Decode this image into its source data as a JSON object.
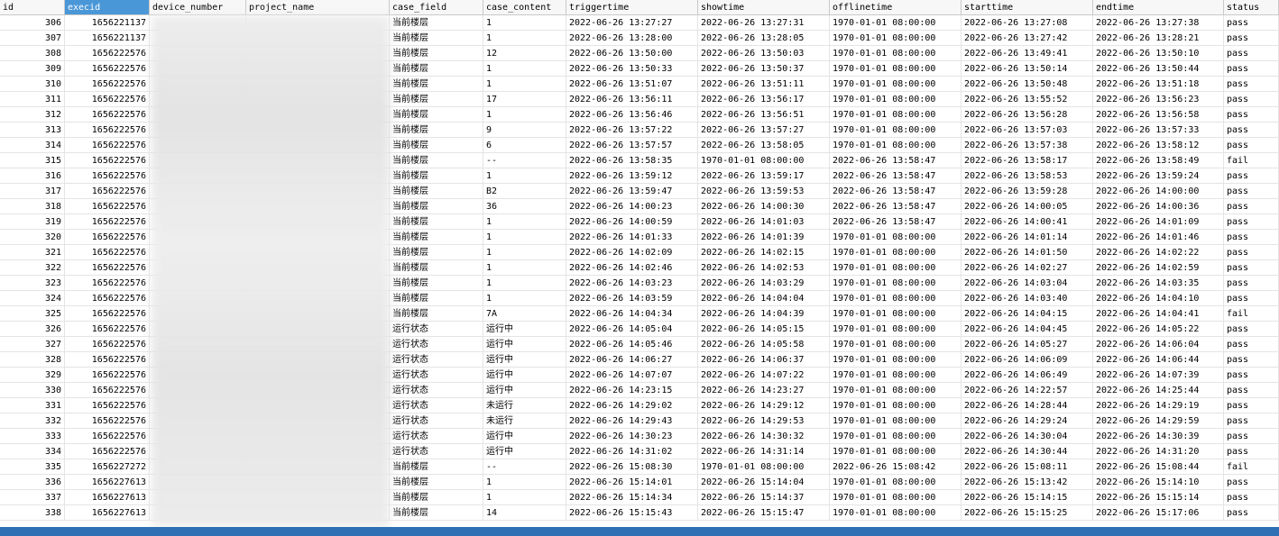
{
  "columns": [
    "id",
    "execid",
    "device_number",
    "project_name",
    "case_field",
    "case_content",
    "triggertime",
    "showtime",
    "offlinetime",
    "starttime",
    "endtime",
    "status"
  ],
  "selected_column": "execid",
  "rows": [
    [
      "306",
      "1656221137",
      "",
      "",
      "当前楼层",
      "1",
      "2022-06-26 13:27:27",
      "2022-06-26 13:27:31",
      "1970-01-01 08:00:00",
      "2022-06-26 13:27:08",
      "2022-06-26 13:27:38",
      "pass"
    ],
    [
      "307",
      "1656221137",
      "",
      "",
      "当前楼层",
      "1",
      "2022-06-26 13:28:00",
      "2022-06-26 13:28:05",
      "1970-01-01 08:00:00",
      "2022-06-26 13:27:42",
      "2022-06-26 13:28:21",
      "pass"
    ],
    [
      "308",
      "1656222576",
      "",
      "",
      "当前楼层",
      "12",
      "2022-06-26 13:50:00",
      "2022-06-26 13:50:03",
      "1970-01-01 08:00:00",
      "2022-06-26 13:49:41",
      "2022-06-26 13:50:10",
      "pass"
    ],
    [
      "309",
      "1656222576",
      "",
      "",
      "当前楼层",
      "1",
      "2022-06-26 13:50:33",
      "2022-06-26 13:50:37",
      "1970-01-01 08:00:00",
      "2022-06-26 13:50:14",
      "2022-06-26 13:50:44",
      "pass"
    ],
    [
      "310",
      "1656222576",
      "",
      "",
      "当前楼层",
      "1",
      "2022-06-26 13:51:07",
      "2022-06-26 13:51:11",
      "1970-01-01 08:00:00",
      "2022-06-26 13:50:48",
      "2022-06-26 13:51:18",
      "pass"
    ],
    [
      "311",
      "1656222576",
      "",
      "",
      "当前楼层",
      "17",
      "2022-06-26 13:56:11",
      "2022-06-26 13:56:17",
      "1970-01-01 08:00:00",
      "2022-06-26 13:55:52",
      "2022-06-26 13:56:23",
      "pass"
    ],
    [
      "312",
      "1656222576",
      "",
      "",
      "当前楼层",
      "1",
      "2022-06-26 13:56:46",
      "2022-06-26 13:56:51",
      "1970-01-01 08:00:00",
      "2022-06-26 13:56:28",
      "2022-06-26 13:56:58",
      "pass"
    ],
    [
      "313",
      "1656222576",
      "",
      "",
      "当前楼层",
      "9",
      "2022-06-26 13:57:22",
      "2022-06-26 13:57:27",
      "1970-01-01 08:00:00",
      "2022-06-26 13:57:03",
      "2022-06-26 13:57:33",
      "pass"
    ],
    [
      "314",
      "1656222576",
      "",
      "",
      "当前楼层",
      "6",
      "2022-06-26 13:57:57",
      "2022-06-26 13:58:05",
      "1970-01-01 08:00:00",
      "2022-06-26 13:57:38",
      "2022-06-26 13:58:12",
      "pass"
    ],
    [
      "315",
      "1656222576",
      "",
      "",
      "当前楼层",
      "--",
      "2022-06-26 13:58:35",
      "1970-01-01 08:00:00",
      "2022-06-26 13:58:47",
      "2022-06-26 13:58:17",
      "2022-06-26 13:58:49",
      "fail"
    ],
    [
      "316",
      "1656222576",
      "",
      "",
      "当前楼层",
      "1",
      "2022-06-26 13:59:12",
      "2022-06-26 13:59:17",
      "2022-06-26 13:58:47",
      "2022-06-26 13:58:53",
      "2022-06-26 13:59:24",
      "pass"
    ],
    [
      "317",
      "1656222576",
      "",
      "",
      "当前楼层",
      "B2",
      "2022-06-26 13:59:47",
      "2022-06-26 13:59:53",
      "2022-06-26 13:58:47",
      "2022-06-26 13:59:28",
      "2022-06-26 14:00:00",
      "pass"
    ],
    [
      "318",
      "1656222576",
      "",
      "",
      "当前楼层",
      "36",
      "2022-06-26 14:00:23",
      "2022-06-26 14:00:30",
      "2022-06-26 13:58:47",
      "2022-06-26 14:00:05",
      "2022-06-26 14:00:36",
      "pass"
    ],
    [
      "319",
      "1656222576",
      "",
      "",
      "当前楼层",
      "1",
      "2022-06-26 14:00:59",
      "2022-06-26 14:01:03",
      "2022-06-26 13:58:47",
      "2022-06-26 14:00:41",
      "2022-06-26 14:01:09",
      "pass"
    ],
    [
      "320",
      "1656222576",
      "",
      "",
      "当前楼层",
      "1",
      "2022-06-26 14:01:33",
      "2022-06-26 14:01:39",
      "1970-01-01 08:00:00",
      "2022-06-26 14:01:14",
      "2022-06-26 14:01:46",
      "pass"
    ],
    [
      "321",
      "1656222576",
      "",
      "",
      "当前楼层",
      "1",
      "2022-06-26 14:02:09",
      "2022-06-26 14:02:15",
      "1970-01-01 08:00:00",
      "2022-06-26 14:01:50",
      "2022-06-26 14:02:22",
      "pass"
    ],
    [
      "322",
      "1656222576",
      "",
      "",
      "当前楼层",
      "1",
      "2022-06-26 14:02:46",
      "2022-06-26 14:02:53",
      "1970-01-01 08:00:00",
      "2022-06-26 14:02:27",
      "2022-06-26 14:02:59",
      "pass"
    ],
    [
      "323",
      "1656222576",
      "",
      "",
      "当前楼层",
      "1",
      "2022-06-26 14:03:23",
      "2022-06-26 14:03:29",
      "1970-01-01 08:00:00",
      "2022-06-26 14:03:04",
      "2022-06-26 14:03:35",
      "pass"
    ],
    [
      "324",
      "1656222576",
      "",
      "",
      "当前楼层",
      "1",
      "2022-06-26 14:03:59",
      "2022-06-26 14:04:04",
      "1970-01-01 08:00:00",
      "2022-06-26 14:03:40",
      "2022-06-26 14:04:10",
      "pass"
    ],
    [
      "325",
      "1656222576",
      "",
      "",
      "当前楼层",
      "7A",
      "2022-06-26 14:04:34",
      "2022-06-26 14:04:39",
      "1970-01-01 08:00:00",
      "2022-06-26 14:04:15",
      "2022-06-26 14:04:41",
      "fail"
    ],
    [
      "326",
      "1656222576",
      "",
      "",
      "运行状态",
      "运行中",
      "2022-06-26 14:05:04",
      "2022-06-26 14:05:15",
      "1970-01-01 08:00:00",
      "2022-06-26 14:04:45",
      "2022-06-26 14:05:22",
      "pass"
    ],
    [
      "327",
      "1656222576",
      "",
      "",
      "运行状态",
      "运行中",
      "2022-06-26 14:05:46",
      "2022-06-26 14:05:58",
      "1970-01-01 08:00:00",
      "2022-06-26 14:05:27",
      "2022-06-26 14:06:04",
      "pass"
    ],
    [
      "328",
      "1656222576",
      "",
      "",
      "运行状态",
      "运行中",
      "2022-06-26 14:06:27",
      "2022-06-26 14:06:37",
      "1970-01-01 08:00:00",
      "2022-06-26 14:06:09",
      "2022-06-26 14:06:44",
      "pass"
    ],
    [
      "329",
      "1656222576",
      "",
      "",
      "运行状态",
      "运行中",
      "2022-06-26 14:07:07",
      "2022-06-26 14:07:22",
      "1970-01-01 08:00:00",
      "2022-06-26 14:06:49",
      "2022-06-26 14:07:39",
      "pass"
    ],
    [
      "330",
      "1656222576",
      "",
      "",
      "运行状态",
      "运行中",
      "2022-06-26 14:23:15",
      "2022-06-26 14:23:27",
      "1970-01-01 08:00:00",
      "2022-06-26 14:22:57",
      "2022-06-26 14:25:44",
      "pass"
    ],
    [
      "331",
      "1656222576",
      "",
      "",
      "运行状态",
      "未运行",
      "2022-06-26 14:29:02",
      "2022-06-26 14:29:12",
      "1970-01-01 08:00:00",
      "2022-06-26 14:28:44",
      "2022-06-26 14:29:19",
      "pass"
    ],
    [
      "332",
      "1656222576",
      "",
      "",
      "运行状态",
      "未运行",
      "2022-06-26 14:29:43",
      "2022-06-26 14:29:53",
      "1970-01-01 08:00:00",
      "2022-06-26 14:29:24",
      "2022-06-26 14:29:59",
      "pass"
    ],
    [
      "333",
      "1656222576",
      "",
      "",
      "运行状态",
      "运行中",
      "2022-06-26 14:30:23",
      "2022-06-26 14:30:32",
      "1970-01-01 08:00:00",
      "2022-06-26 14:30:04",
      "2022-06-26 14:30:39",
      "pass"
    ],
    [
      "334",
      "1656222576",
      "",
      "",
      "运行状态",
      "运行中",
      "2022-06-26 14:31:02",
      "2022-06-26 14:31:14",
      "1970-01-01 08:00:00",
      "2022-06-26 14:30:44",
      "2022-06-26 14:31:20",
      "pass"
    ],
    [
      "335",
      "1656227272",
      "",
      "",
      "当前楼层",
      "--",
      "2022-06-26 15:08:30",
      "1970-01-01 08:00:00",
      "2022-06-26 15:08:42",
      "2022-06-26 15:08:11",
      "2022-06-26 15:08:44",
      "fail"
    ],
    [
      "336",
      "1656227613",
      "",
      "",
      "当前楼层",
      "1",
      "2022-06-26 15:14:01",
      "2022-06-26 15:14:04",
      "1970-01-01 08:00:00",
      "2022-06-26 15:13:42",
      "2022-06-26 15:14:10",
      "pass"
    ],
    [
      "337",
      "1656227613",
      "",
      "",
      "当前楼层",
      "1",
      "2022-06-26 15:14:34",
      "2022-06-26 15:14:37",
      "1970-01-01 08:00:00",
      "2022-06-26 15:14:15",
      "2022-06-26 15:15:14",
      "pass"
    ],
    [
      "338",
      "1656227613",
      "",
      "",
      "当前楼层",
      "14",
      "2022-06-26 15:15:43",
      "2022-06-26 15:15:47",
      "1970-01-01 08:00:00",
      "2022-06-26 15:15:25",
      "2022-06-26 15:17:06",
      "pass"
    ]
  ],
  "colors": {
    "header_bg": "#f7f7f7",
    "selected_header_bg": "#4a97d8",
    "statusbar_bg": "#2f6fb3"
  }
}
